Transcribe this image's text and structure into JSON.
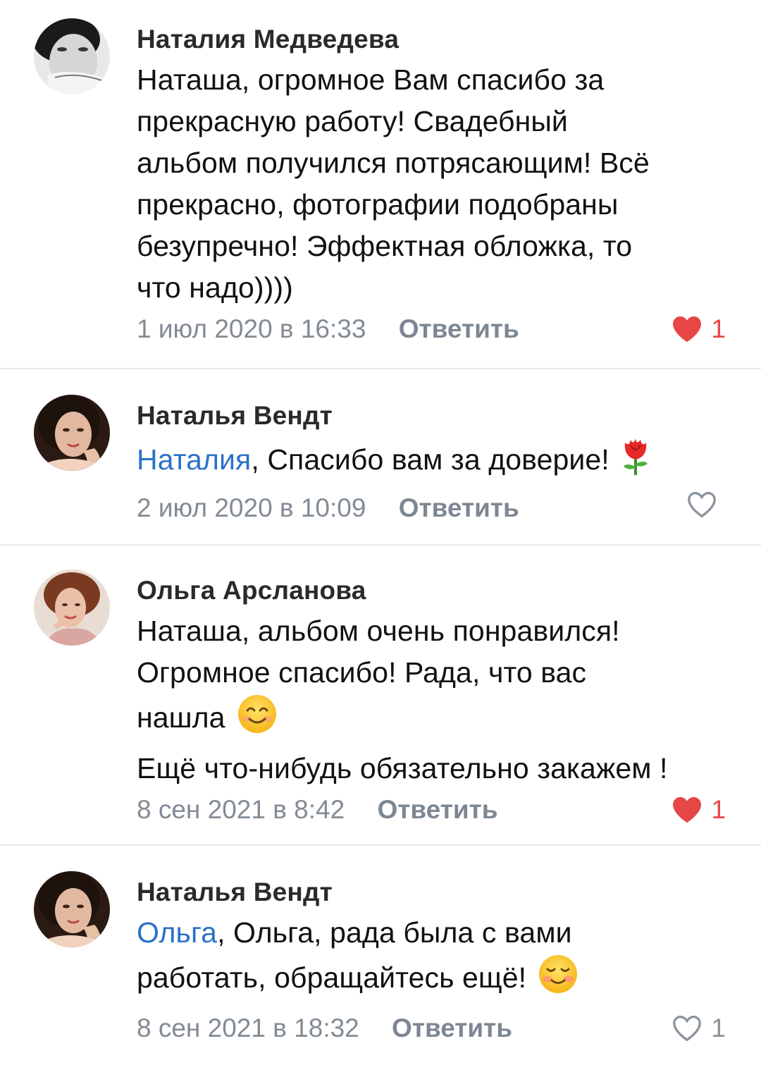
{
  "comments": [
    {
      "author": "Наталия Медведева",
      "lines": [
        "Наташа, огромное Вам спасибо за",
        "прекрасную работу! Свадебный",
        "альбом получился потрясающим! Всё",
        "прекрасно, фотографии подобраны",
        "безупречно! Эффектная обложка, то",
        "что надо))))"
      ],
      "date": "1 июл 2020 в 16:33",
      "reply_label": "Ответить",
      "likes": "1",
      "liked": true,
      "like_icon": "heart-filled-icon"
    },
    {
      "author": "Наталья Вендт",
      "mention": "Наталия",
      "text": ", Спасибо вам за доверие!",
      "emoji": "rose-emoji",
      "date": "2 июл 2020 в 10:09",
      "reply_label": "Ответить",
      "likes": "",
      "liked": false,
      "like_icon": "heart-outline-icon"
    },
    {
      "author": "Ольга Арсланова",
      "line1": "Наташа, альбом очень понравился!",
      "line2": "Огромное спасибо! Рада, что вас",
      "line3": "нашла",
      "line3_emoji": "smiling-face-emoji",
      "line4": "Ещё что-нибудь обязательно закажем !",
      "date": "8 сен 2021 в 8:42",
      "reply_label": "Ответить",
      "likes": "1",
      "liked": true,
      "like_icon": "heart-filled-icon"
    },
    {
      "author": "Наталья Вендт",
      "mention": "Ольга",
      "line1": ", Ольга, рада была с вами",
      "line2": "работать, обращайтесь ещё!",
      "line2_emoji": "smiling-face-blush-emoji",
      "date": "8 сен 2021 в 18:32",
      "reply_label": "Ответить",
      "likes": "1",
      "liked": false,
      "like_icon": "heart-outline-icon"
    }
  ],
  "colors": {
    "mention": "#2a72c9",
    "like_active": "#e64646",
    "meta": "#828b95",
    "divider": "#e4e6ea"
  }
}
